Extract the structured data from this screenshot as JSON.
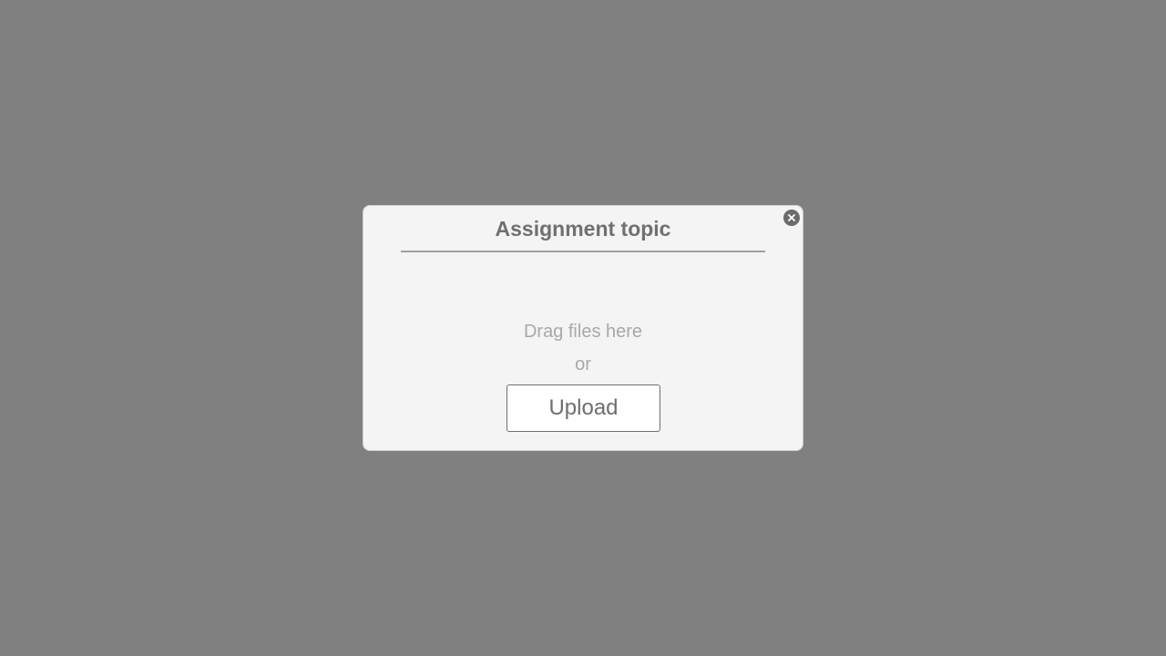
{
  "dialog": {
    "title": "Assignment topic",
    "drop_hint": "Drag files here",
    "separator_text": "or",
    "upload_label": "Upload",
    "close_icon": "close-icon"
  },
  "colors": {
    "overlay": "#808080",
    "dialog_background": "#f4f4f4",
    "title_text": "#707070",
    "hint_text": "#a8a8a8",
    "close_button": "#6b6b6b"
  }
}
